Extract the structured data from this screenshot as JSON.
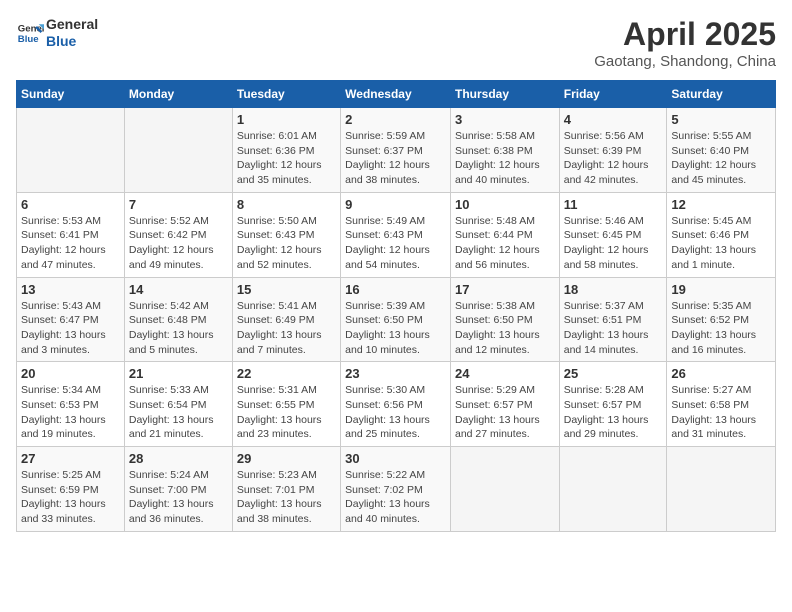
{
  "header": {
    "logo_line1": "General",
    "logo_line2": "Blue",
    "month_title": "April 2025",
    "subtitle": "Gaotang, Shandong, China"
  },
  "columns": [
    "Sunday",
    "Monday",
    "Tuesday",
    "Wednesday",
    "Thursday",
    "Friday",
    "Saturday"
  ],
  "weeks": [
    [
      {
        "day": "",
        "info": ""
      },
      {
        "day": "",
        "info": ""
      },
      {
        "day": "1",
        "info": "Sunrise: 6:01 AM\nSunset: 6:36 PM\nDaylight: 12 hours and 35 minutes."
      },
      {
        "day": "2",
        "info": "Sunrise: 5:59 AM\nSunset: 6:37 PM\nDaylight: 12 hours and 38 minutes."
      },
      {
        "day": "3",
        "info": "Sunrise: 5:58 AM\nSunset: 6:38 PM\nDaylight: 12 hours and 40 minutes."
      },
      {
        "day": "4",
        "info": "Sunrise: 5:56 AM\nSunset: 6:39 PM\nDaylight: 12 hours and 42 minutes."
      },
      {
        "day": "5",
        "info": "Sunrise: 5:55 AM\nSunset: 6:40 PM\nDaylight: 12 hours and 45 minutes."
      }
    ],
    [
      {
        "day": "6",
        "info": "Sunrise: 5:53 AM\nSunset: 6:41 PM\nDaylight: 12 hours and 47 minutes."
      },
      {
        "day": "7",
        "info": "Sunrise: 5:52 AM\nSunset: 6:42 PM\nDaylight: 12 hours and 49 minutes."
      },
      {
        "day": "8",
        "info": "Sunrise: 5:50 AM\nSunset: 6:43 PM\nDaylight: 12 hours and 52 minutes."
      },
      {
        "day": "9",
        "info": "Sunrise: 5:49 AM\nSunset: 6:43 PM\nDaylight: 12 hours and 54 minutes."
      },
      {
        "day": "10",
        "info": "Sunrise: 5:48 AM\nSunset: 6:44 PM\nDaylight: 12 hours and 56 minutes."
      },
      {
        "day": "11",
        "info": "Sunrise: 5:46 AM\nSunset: 6:45 PM\nDaylight: 12 hours and 58 minutes."
      },
      {
        "day": "12",
        "info": "Sunrise: 5:45 AM\nSunset: 6:46 PM\nDaylight: 13 hours and 1 minute."
      }
    ],
    [
      {
        "day": "13",
        "info": "Sunrise: 5:43 AM\nSunset: 6:47 PM\nDaylight: 13 hours and 3 minutes."
      },
      {
        "day": "14",
        "info": "Sunrise: 5:42 AM\nSunset: 6:48 PM\nDaylight: 13 hours and 5 minutes."
      },
      {
        "day": "15",
        "info": "Sunrise: 5:41 AM\nSunset: 6:49 PM\nDaylight: 13 hours and 7 minutes."
      },
      {
        "day": "16",
        "info": "Sunrise: 5:39 AM\nSunset: 6:50 PM\nDaylight: 13 hours and 10 minutes."
      },
      {
        "day": "17",
        "info": "Sunrise: 5:38 AM\nSunset: 6:50 PM\nDaylight: 13 hours and 12 minutes."
      },
      {
        "day": "18",
        "info": "Sunrise: 5:37 AM\nSunset: 6:51 PM\nDaylight: 13 hours and 14 minutes."
      },
      {
        "day": "19",
        "info": "Sunrise: 5:35 AM\nSunset: 6:52 PM\nDaylight: 13 hours and 16 minutes."
      }
    ],
    [
      {
        "day": "20",
        "info": "Sunrise: 5:34 AM\nSunset: 6:53 PM\nDaylight: 13 hours and 19 minutes."
      },
      {
        "day": "21",
        "info": "Sunrise: 5:33 AM\nSunset: 6:54 PM\nDaylight: 13 hours and 21 minutes."
      },
      {
        "day": "22",
        "info": "Sunrise: 5:31 AM\nSunset: 6:55 PM\nDaylight: 13 hours and 23 minutes."
      },
      {
        "day": "23",
        "info": "Sunrise: 5:30 AM\nSunset: 6:56 PM\nDaylight: 13 hours and 25 minutes."
      },
      {
        "day": "24",
        "info": "Sunrise: 5:29 AM\nSunset: 6:57 PM\nDaylight: 13 hours and 27 minutes."
      },
      {
        "day": "25",
        "info": "Sunrise: 5:28 AM\nSunset: 6:57 PM\nDaylight: 13 hours and 29 minutes."
      },
      {
        "day": "26",
        "info": "Sunrise: 5:27 AM\nSunset: 6:58 PM\nDaylight: 13 hours and 31 minutes."
      }
    ],
    [
      {
        "day": "27",
        "info": "Sunrise: 5:25 AM\nSunset: 6:59 PM\nDaylight: 13 hours and 33 minutes."
      },
      {
        "day": "28",
        "info": "Sunrise: 5:24 AM\nSunset: 7:00 PM\nDaylight: 13 hours and 36 minutes."
      },
      {
        "day": "29",
        "info": "Sunrise: 5:23 AM\nSunset: 7:01 PM\nDaylight: 13 hours and 38 minutes."
      },
      {
        "day": "30",
        "info": "Sunrise: 5:22 AM\nSunset: 7:02 PM\nDaylight: 13 hours and 40 minutes."
      },
      {
        "day": "",
        "info": ""
      },
      {
        "day": "",
        "info": ""
      },
      {
        "day": "",
        "info": ""
      }
    ]
  ]
}
